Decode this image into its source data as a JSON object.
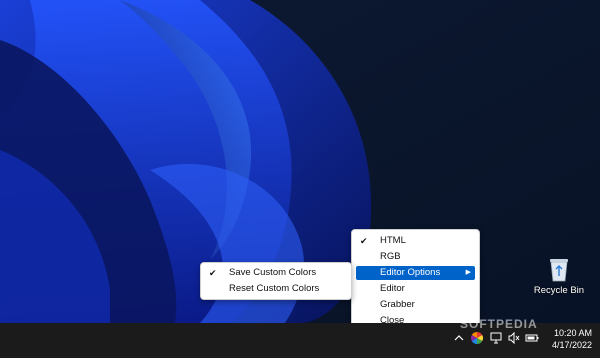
{
  "desktop": {
    "recycle_bin": {
      "label": "Recycle Bin",
      "icon": "recycle-bin-icon"
    }
  },
  "main_menu": {
    "items": [
      {
        "label": "HTML",
        "checked": true,
        "highlighted": false
      },
      {
        "label": "RGB",
        "checked": false,
        "highlighted": false
      },
      {
        "label": "Editor Options",
        "checked": false,
        "highlighted": true,
        "has_submenu": true
      },
      {
        "label": "Editor",
        "checked": false,
        "highlighted": false
      },
      {
        "label": "Grabber",
        "checked": false,
        "highlighted": false
      },
      {
        "label": "Close",
        "checked": false,
        "highlighted": false
      }
    ]
  },
  "sub_menu": {
    "items": [
      {
        "label": "Save Custom Colors",
        "checked": true
      },
      {
        "label": "Reset Custom Colors",
        "checked": false
      }
    ]
  },
  "taskbar": {
    "time": "10:20 AM",
    "date": "4/17/2022",
    "watermark": "SOFTPEDIA"
  },
  "colors": {
    "highlight": "#0063c9",
    "taskbar": "#1b1b1b"
  }
}
